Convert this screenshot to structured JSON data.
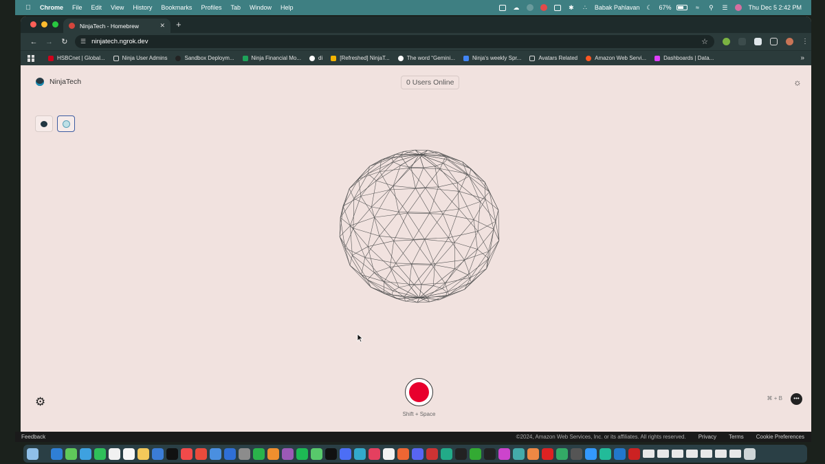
{
  "menubar": {
    "app_name": "Chrome",
    "menus": [
      "File",
      "Edit",
      "View",
      "History",
      "Bookmarks",
      "Profiles",
      "Tab",
      "Window",
      "Help"
    ],
    "battery": "67%",
    "user": "Babak Pahlavan",
    "datetime": "Thu Dec 5  2:42 PM"
  },
  "browser": {
    "tab_title": "NinjaTech - Homebrew",
    "url": "ninjatech.ngrok.dev",
    "bookmarks": [
      {
        "label": "HSBCnet | Global...",
        "icon_color": "#d0021b"
      },
      {
        "label": "Ninja User Admins",
        "icon_color": "folder"
      },
      {
        "label": "Sandbox Deploym...",
        "icon_color": "#222222"
      },
      {
        "label": "Ninja Financial Mo...",
        "icon_color": "#1ea35a"
      },
      {
        "label": "di",
        "icon_color": "#ffffff"
      },
      {
        "label": "[Refreshed] NinjaT...",
        "icon_color": "#f4b400"
      },
      {
        "label": "The word “Gemini...",
        "icon_color": "#ffffff"
      },
      {
        "label": "Ninja's weekly Spr...",
        "icon_color": "#4285f4"
      },
      {
        "label": "Avatars Related",
        "icon_color": "folder"
      },
      {
        "label": "Amazon Web Servi...",
        "icon_color": "#ff5722"
      },
      {
        "label": "Dashboards | Data...",
        "icon_color": "#e040fb"
      }
    ]
  },
  "app": {
    "brand": "NinjaTech",
    "users_online": "0 Users Online",
    "record_hint": "Shift + Space",
    "chat_shortcut": "⌘ + B"
  },
  "footer": {
    "feedback": "Feedback",
    "copyright": "©2024, Amazon Web Services, Inc. or its affiliates. All rights reserved.",
    "links": [
      "Privacy",
      "Terms",
      "Cookie Preferences"
    ]
  },
  "colors": {
    "page_bg": "#f1e2df",
    "record_red": "#e8002d",
    "menubar_bg": "#3e7f82",
    "chrome_bg": "#2b3b3b"
  },
  "icons": {
    "theme_toggle": "sun-icon",
    "settings": "gear-icon",
    "chat": "chat-bubble-icon",
    "record": "record-icon"
  }
}
